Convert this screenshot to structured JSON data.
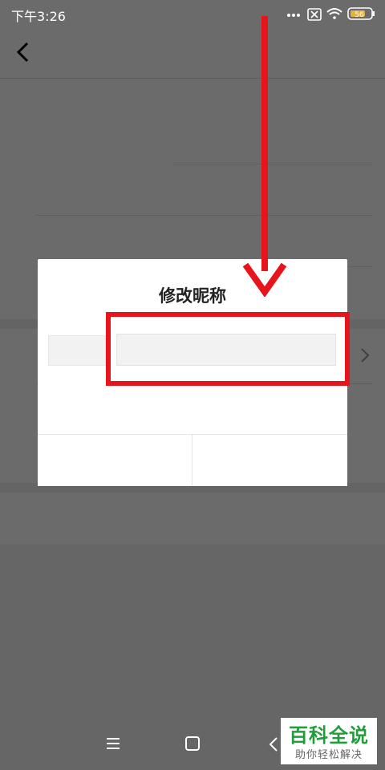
{
  "status_bar": {
    "time": "下午3:26",
    "battery": "56",
    "icons": [
      "more-dots-icon",
      "sim-x-icon",
      "wifi-icon",
      "battery-icon"
    ]
  },
  "dialog": {
    "title": "修改昵称",
    "input_value": "",
    "input_placeholder": ""
  },
  "watermark": {
    "title": "百科全说",
    "subtitle": "助你轻松解决"
  },
  "colors": {
    "annotation_red": "#e8141b",
    "watermark_green": "#1f9e3a"
  }
}
